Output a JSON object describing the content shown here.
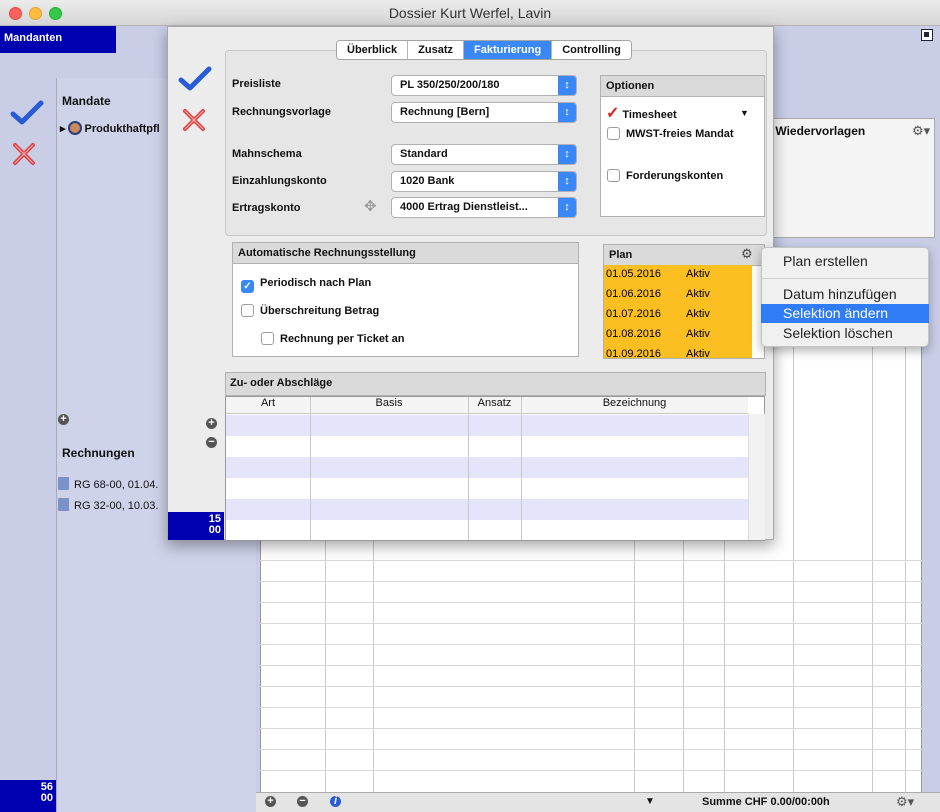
{
  "window": {
    "title": "Dossier Kurt Werfel, Lavin"
  },
  "sidebar": {
    "mandanten_label": "Mandanten",
    "mandate_header": "Mandate",
    "mandate_item": "Produkthaftpfl",
    "rechnungen_header": "Rechnungen",
    "rechnungen": [
      "RG 68-00, 01.04.",
      "RG 32-00, 10.03."
    ],
    "counter_top": "56",
    "counter_bottom": "00"
  },
  "background": {
    "right_header": "e, Wiedervorlagen",
    "summe": "Summe CHF 0.00/00:00h"
  },
  "dialog": {
    "tabs": [
      {
        "label": "Überblick",
        "active": false
      },
      {
        "label": "Zusatz",
        "active": false
      },
      {
        "label": "Fakturierung",
        "active": true
      },
      {
        "label": "Controlling",
        "active": false
      }
    ],
    "fields": {
      "preisliste": {
        "label": "Preisliste",
        "value": "PL 350/250/200/180"
      },
      "rechnungsvorlage": {
        "label": "Rechnungsvorlage",
        "value": "Rechnung [Bern]"
      },
      "mahnschema": {
        "label": "Mahnschema",
        "value": "Standard"
      },
      "einzahlungskonto": {
        "label": "Einzahlungskonto",
        "value": "1020 Bank"
      },
      "ertragskonto": {
        "label": "Ertragskonto",
        "value": "4000 Ertrag Dienstleist..."
      }
    },
    "optionen": {
      "header": "Optionen",
      "timesheet": "Timesheet",
      "mwst": "MWST-freies Mandat",
      "forderung": "Forderungskonten"
    },
    "auto": {
      "header": "Automatische Rechnungsstellung",
      "periodisch": "Periodisch nach Plan",
      "periodisch_checked": true,
      "ueberschreitung": "Überschreitung Betrag",
      "ticket": "Rechnung per Ticket an"
    },
    "plan": {
      "header": "Plan",
      "rows": [
        {
          "date": "01.05.2016",
          "status": "Aktiv"
        },
        {
          "date": "01.06.2016",
          "status": "Aktiv"
        },
        {
          "date": "01.07.2016",
          "status": "Aktiv"
        },
        {
          "date": "01.08.2016",
          "status": "Aktiv"
        },
        {
          "date": "01.09.2016",
          "status": "Aktiv"
        }
      ]
    },
    "zu": {
      "header": "Zu- oder Abschläge",
      "columns": [
        "Art",
        "Basis",
        "Ansatz",
        "Bezeichnung"
      ]
    },
    "counter_top": "15",
    "counter_bottom": "00"
  },
  "context_menu": {
    "items": [
      {
        "label": "Plan erstellen",
        "highlighted": false
      },
      {
        "label": "Datum hinzufügen",
        "highlighted": false
      },
      {
        "label": "Selektion ändern",
        "highlighted": true
      },
      {
        "label": "Selektion löschen",
        "highlighted": false
      }
    ]
  },
  "colors": {
    "accent": "#3a88f5",
    "plan_highlight": "#fbbf22",
    "brand_blue": "#0000b0"
  }
}
